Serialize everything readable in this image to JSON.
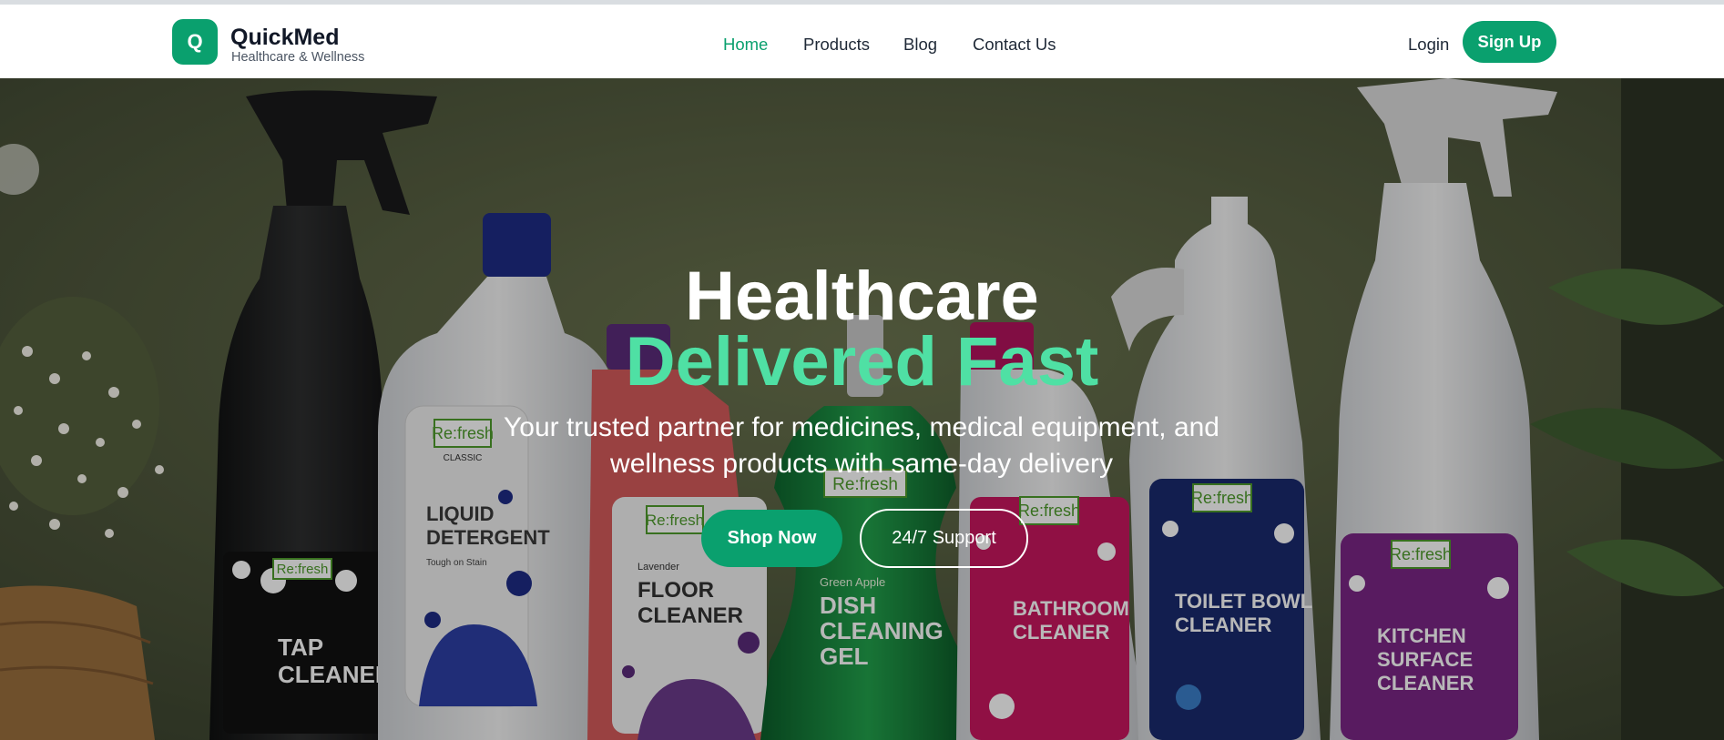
{
  "brand": {
    "logo_letter": "Q",
    "name": "QuickMed",
    "tagline": "Healthcare & Wellness"
  },
  "nav": {
    "items": [
      "Home",
      "Products",
      "Blog",
      "Contact Us"
    ],
    "active": "Home"
  },
  "auth": {
    "login": "Login",
    "signup": "Sign Up"
  },
  "hero": {
    "headline_line1": "Healthcare",
    "headline_line2": "Delivered Fast",
    "subtitle": "Your trusted partner for medicines, medical equipment, and wellness products with same-day delivery",
    "primary_cta": "Shop Now",
    "secondary_cta": "24/7 Support"
  },
  "product_labels": {
    "brand": "Re:fresh",
    "classic": "CLASSIC",
    "tap": [
      "TAP",
      "CLEANER"
    ],
    "detergent": [
      "LIQUID",
      "DETERGENT"
    ],
    "detergent_note": "Tough on Stain",
    "floor_variant": "Lavender",
    "floor": [
      "FLOOR",
      "CLEANER"
    ],
    "dish_variant": "Green Apple",
    "dish": [
      "DISH",
      "CLEANING",
      "GEL"
    ],
    "bathroom": [
      "BATHROOM",
      "CLEANER"
    ],
    "toilet": [
      "TOILET BOWL",
      "CLEANER"
    ],
    "kitchen": [
      "KITCHEN",
      "SURFACE",
      "CLEANER"
    ]
  },
  "colors": {
    "accent": "#0aa06e",
    "headline_accent": "#4fe0a4",
    "hero_bg": "#5c6545"
  }
}
